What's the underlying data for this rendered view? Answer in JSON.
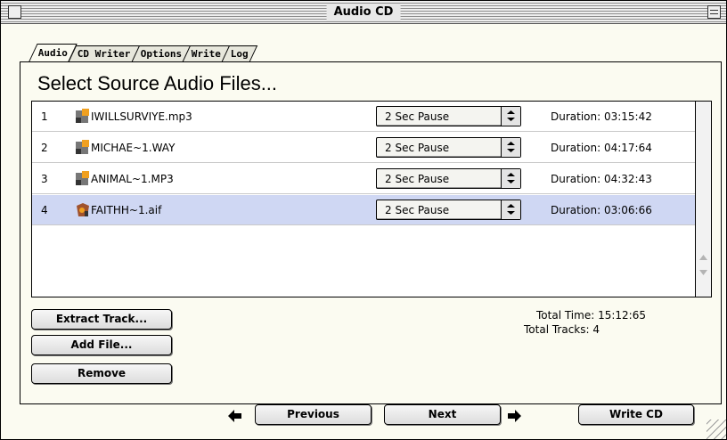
{
  "window": {
    "title": "Audio CD"
  },
  "tabs": [
    {
      "label": "Audio",
      "active": true
    },
    {
      "label": "CD Writer",
      "active": false
    },
    {
      "label": "Options",
      "active": false
    },
    {
      "label": "Write",
      "active": false
    },
    {
      "label": "Log",
      "active": false
    }
  ],
  "section_title": "Select Source Audio Files...",
  "tracks": [
    {
      "num": "1",
      "file": "IWILLSURVIYE.mp3",
      "pause": "2 Sec Pause",
      "duration": "Duration: 03:15:42",
      "icon": "audio-file-icon",
      "selected": false
    },
    {
      "num": "2",
      "file": "MICHAE~1.WAY",
      "pause": "2 Sec Pause",
      "duration": "Duration: 04:17:64",
      "icon": "audio-file-icon",
      "selected": false
    },
    {
      "num": "3",
      "file": "ANIMAL~1.MP3",
      "pause": "2 Sec Pause",
      "duration": "Duration: 04:32:43",
      "icon": "audio-file-icon",
      "selected": false
    },
    {
      "num": "4",
      "file": "FAITHH~1.aif",
      "pause": "2 Sec Pause",
      "duration": "Duration: 03:06:66",
      "icon": "aiff-file-icon",
      "selected": true
    }
  ],
  "buttons": {
    "extract": "Extract Track...",
    "add": "Add File...",
    "remove": "Remove",
    "previous": "Previous",
    "next": "Next",
    "write": "Write CD"
  },
  "totals": {
    "time": "Total Time: 15:12:65",
    "tracks": "Total Tracks: 4"
  },
  "colors": {
    "window_bg": "#fbfbf1",
    "selection": "#cfd7f3"
  }
}
